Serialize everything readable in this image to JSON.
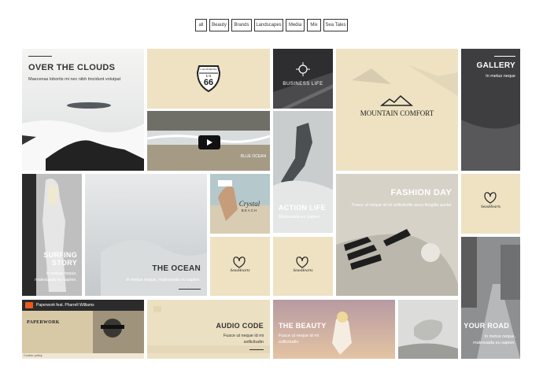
{
  "filters": [
    "all",
    "Beauty",
    "Brands",
    "Landscapes",
    "Media",
    "Mix",
    "Sea Tales"
  ],
  "tiles": {
    "over_clouds": {
      "title": "OVER THE CLOUDS",
      "subtitle": "Maecenas lobortis mi nec nibh tincidunt volutpat"
    },
    "gallery": {
      "title": "GALLERY",
      "subtitle": "In metus neque"
    },
    "business_life": {
      "logo": "BUSINESS LIFE"
    },
    "mountain_comfort": {
      "logo": "MOUNTAIN COMFORT"
    },
    "route66": {
      "top": "CALIFORNIA",
      "mid": "U S",
      "num": "66"
    },
    "blue_ocean": {
      "logo": "BLUE OCEAN"
    },
    "fashion_day": {
      "title": "FASHION DAY",
      "subtitle": "Fusce ut neque id mi sollicitudin accu fringilla auctor"
    },
    "action_life": {
      "title": "ACTION LIFE",
      "subtitle": "Malesuada eu sapien"
    },
    "crystal_beach": {
      "line1": "Crystal",
      "line2": "BEACH"
    },
    "surfing_story": {
      "title1": "SURFING",
      "title2": "STORY",
      "sub1": "In metus neque,",
      "sub2": "malesuada eu sapien."
    },
    "the_ocean": {
      "title": "THE OCEAN",
      "subtitle": "In metus neque, malesuada eu sapien."
    },
    "seahearts": {
      "logo": "SeasHearts"
    },
    "audio_code": {
      "title": "AUDIO CODE",
      "sub1": "Fusce ut neque id mi",
      "sub2": "sollicitudin"
    },
    "the_beauty": {
      "title": "THE BEAUTY",
      "sub1": "Fusce ut neque id mi",
      "sub2": "sollicitudin"
    },
    "your_road": {
      "title": "YOUR ROAD",
      "sub1": "In metus neque,",
      "sub2": "malesuada eu sapien."
    },
    "video": {
      "channel": "Paperwork feat. Pharrell Williams",
      "poster_title": "PAPERWORK",
      "footer": "Cookie policy"
    }
  },
  "colors": {
    "beige": "#eee2c3",
    "dark": "#2e2e30",
    "text_dark": "#333333",
    "white": "#ffffff"
  }
}
